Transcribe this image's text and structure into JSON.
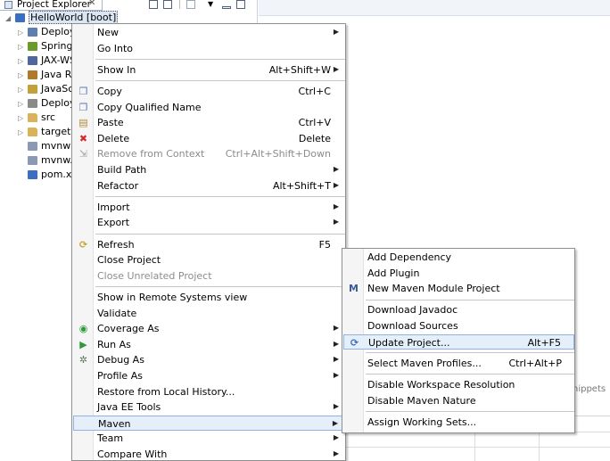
{
  "explorer": {
    "tab_title": "Project Explorer",
    "tab_close": "✕",
    "tree": [
      {
        "label": "HelloWorld [boot]",
        "icon": "project-icon",
        "color": "#3a6fc2"
      },
      {
        "label": "Deploy",
        "icon": "deployment-descriptor-icon",
        "color": "#5a7fb0"
      },
      {
        "label": "Spring",
        "icon": "spring-icon",
        "color": "#6a9a2a"
      },
      {
        "label": "JAX-WS",
        "icon": "jaxws-icon",
        "color": "#5066a0"
      },
      {
        "label": "Java Re",
        "icon": "java-library-icon",
        "color": "#b07a2a"
      },
      {
        "label": "JavaScr",
        "icon": "javascript-resources-icon",
        "color": "#c2a03a"
      },
      {
        "label": "Deploy",
        "icon": "deployed-resources-icon",
        "color": "#8a8a8a"
      },
      {
        "label": "src",
        "icon": "folder-icon",
        "color": "#d9b25a"
      },
      {
        "label": "target",
        "icon": "folder-icon",
        "color": "#d9b25a"
      },
      {
        "label": "mvnw",
        "icon": "file-icon",
        "color": "#8a9ab5"
      },
      {
        "label": "mvnw.c",
        "icon": "file-icon",
        "color": "#8a9ab5"
      },
      {
        "label": "pom.xn",
        "icon": "maven-pom-icon",
        "color": "#3a6fc2"
      }
    ]
  },
  "editor": {
    "snippets_label": "nippets"
  },
  "context_menu": {
    "items": [
      {
        "type": "item",
        "label": "New",
        "accel": "",
        "submenu": true,
        "icon": ""
      },
      {
        "type": "item",
        "label": "Go Into",
        "accel": "",
        "submenu": false,
        "icon": ""
      },
      {
        "type": "sep"
      },
      {
        "type": "item",
        "label": "Show In",
        "accel": "Alt+Shift+W",
        "submenu": true,
        "icon": ""
      },
      {
        "type": "sep"
      },
      {
        "type": "item",
        "label": "Copy",
        "accel": "Ctrl+C",
        "submenu": false,
        "icon": "copy-icon"
      },
      {
        "type": "item",
        "label": "Copy Qualified Name",
        "accel": "",
        "submenu": false,
        "icon": "copy-qualified-icon"
      },
      {
        "type": "item",
        "label": "Paste",
        "accel": "Ctrl+V",
        "submenu": false,
        "icon": "paste-icon"
      },
      {
        "type": "item",
        "label": "Delete",
        "accel": "Delete",
        "submenu": false,
        "icon": "delete-icon"
      },
      {
        "type": "item",
        "label": "Remove from Context",
        "accel": "Ctrl+Alt+Shift+Down",
        "submenu": false,
        "icon": "remove-context-icon",
        "disabled": true
      },
      {
        "type": "item",
        "label": "Build Path",
        "accel": "",
        "submenu": true,
        "icon": ""
      },
      {
        "type": "item",
        "label": "Refactor",
        "accel": "Alt+Shift+T",
        "submenu": true,
        "icon": ""
      },
      {
        "type": "sep"
      },
      {
        "type": "item",
        "label": "Import",
        "accel": "",
        "submenu": true,
        "icon": ""
      },
      {
        "type": "item",
        "label": "Export",
        "accel": "",
        "submenu": true,
        "icon": ""
      },
      {
        "type": "sep"
      },
      {
        "type": "item",
        "label": "Refresh",
        "accel": "F5",
        "submenu": false,
        "icon": "refresh-icon"
      },
      {
        "type": "item",
        "label": "Close Project",
        "accel": "",
        "submenu": false,
        "icon": ""
      },
      {
        "type": "item",
        "label": "Close Unrelated Project",
        "accel": "",
        "submenu": false,
        "icon": "",
        "disabled": true
      },
      {
        "type": "sep"
      },
      {
        "type": "item",
        "label": "Show in Remote Systems view",
        "accel": "",
        "submenu": false,
        "icon": ""
      },
      {
        "type": "item",
        "label": "Validate",
        "accel": "",
        "submenu": false,
        "icon": ""
      },
      {
        "type": "item",
        "label": "Coverage As",
        "accel": "",
        "submenu": true,
        "icon": "coverage-icon"
      },
      {
        "type": "item",
        "label": "Run As",
        "accel": "",
        "submenu": true,
        "icon": "run-icon"
      },
      {
        "type": "item",
        "label": "Debug As",
        "accel": "",
        "submenu": true,
        "icon": "debug-icon"
      },
      {
        "type": "item",
        "label": "Profile As",
        "accel": "",
        "submenu": true,
        "icon": ""
      },
      {
        "type": "item",
        "label": "Restore from Local History...",
        "accel": "",
        "submenu": false,
        "icon": ""
      },
      {
        "type": "item",
        "label": "Java EE Tools",
        "accel": "",
        "submenu": true,
        "icon": ""
      },
      {
        "type": "item",
        "label": "Maven",
        "accel": "",
        "submenu": true,
        "icon": "",
        "highlighted": true
      },
      {
        "type": "item",
        "label": "Team",
        "accel": "",
        "submenu": true,
        "icon": ""
      },
      {
        "type": "item",
        "label": "Compare With",
        "accel": "",
        "submenu": true,
        "icon": ""
      }
    ]
  },
  "maven_submenu": {
    "items": [
      {
        "type": "item",
        "label": "Add Dependency",
        "accel": "",
        "icon": ""
      },
      {
        "type": "item",
        "label": "Add Plugin",
        "accel": "",
        "icon": ""
      },
      {
        "type": "item",
        "label": "New Maven Module Project",
        "accel": "",
        "icon": "maven-module-icon"
      },
      {
        "type": "sep"
      },
      {
        "type": "item",
        "label": "Download Javadoc",
        "accel": "",
        "icon": ""
      },
      {
        "type": "item",
        "label": "Download Sources",
        "accel": "",
        "icon": ""
      },
      {
        "type": "item",
        "label": "Update Project...",
        "accel": "Alt+F5",
        "icon": "update-project-icon",
        "highlighted": true
      },
      {
        "type": "sep"
      },
      {
        "type": "item",
        "label": "Select Maven Profiles...",
        "accel": "Ctrl+Alt+P",
        "icon": ""
      },
      {
        "type": "sep"
      },
      {
        "type": "item",
        "label": "Disable Workspace Resolution",
        "accel": "",
        "icon": ""
      },
      {
        "type": "item",
        "label": "Disable Maven Nature",
        "accel": "",
        "icon": ""
      },
      {
        "type": "sep"
      },
      {
        "type": "item",
        "label": "Assign Working Sets...",
        "accel": "",
        "icon": ""
      }
    ]
  },
  "colors": {
    "highlight_bg": "#e5effa",
    "highlight_border": "#8db2e3",
    "disabled_text": "#8c8c8c",
    "delete_red": "#d42a2a",
    "run_green": "#2e9a3a"
  }
}
